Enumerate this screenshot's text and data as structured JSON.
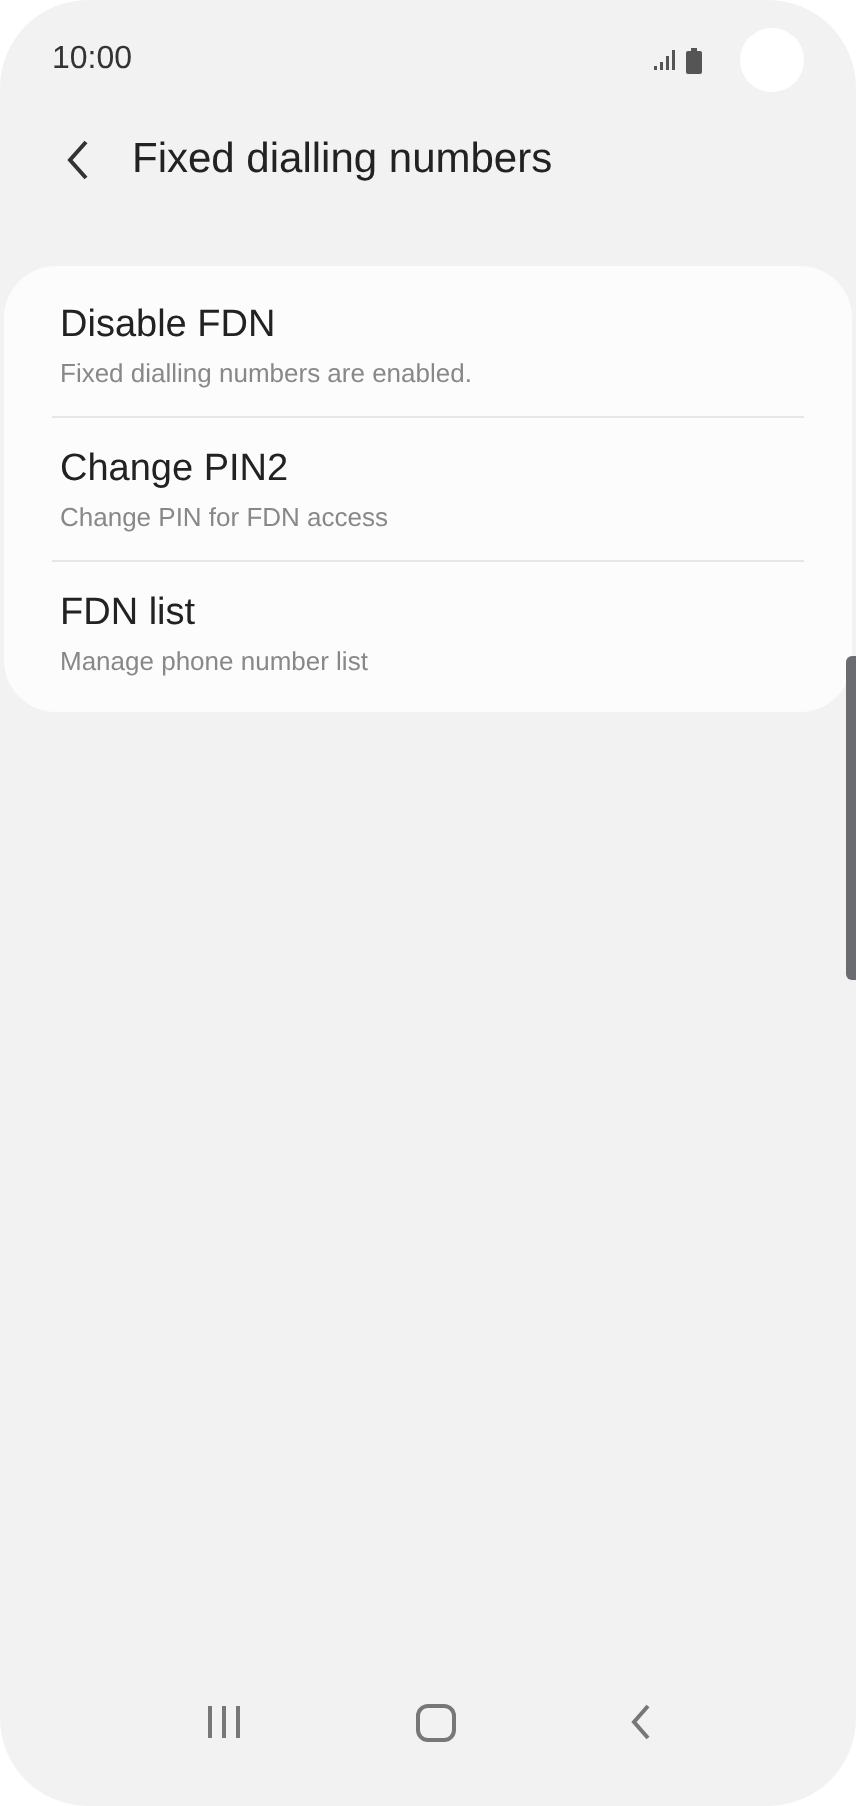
{
  "status_bar": {
    "time": "10:00"
  },
  "header": {
    "title": "Fixed dialling numbers"
  },
  "items": [
    {
      "title": "Disable FDN",
      "subtitle": "Fixed dialling numbers are enabled."
    },
    {
      "title": "Change PIN2",
      "subtitle": "Change PIN for FDN access"
    },
    {
      "title": "FDN list",
      "subtitle": "Manage phone number list"
    }
  ]
}
